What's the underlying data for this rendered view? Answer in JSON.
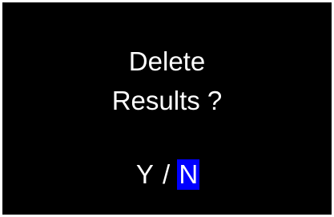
{
  "dialog": {
    "line1": "Delete",
    "line2": "Results ?",
    "options": [
      {
        "label": "Y",
        "selected": false
      },
      {
        "label": "N",
        "selected": true
      }
    ],
    "separator": " / "
  },
  "colors": {
    "background": "#000000",
    "text": "#ffffff",
    "selection": "#0000ff",
    "frame": "#ffffff"
  }
}
